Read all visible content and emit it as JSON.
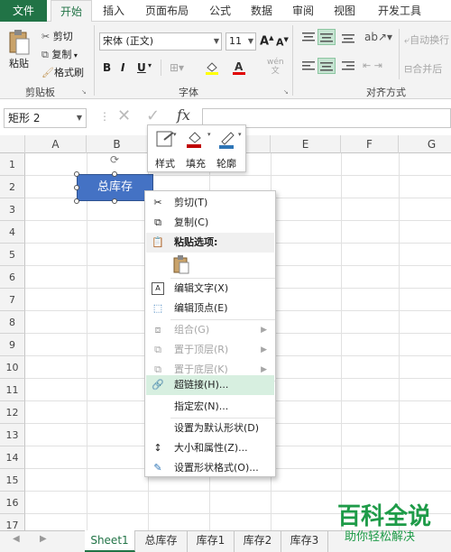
{
  "ribbon_tabs": [
    "文件",
    "开始",
    "插入",
    "页面布局",
    "公式",
    "数据",
    "审阅",
    "视图",
    "开发工具"
  ],
  "clipboard": {
    "paste": "粘贴",
    "cut": "剪切",
    "copy": "复制",
    "format_painter": "格式刷",
    "group": "剪贴板"
  },
  "font": {
    "name": "宋体 (正文)",
    "size": "11",
    "bold": "B",
    "italic": "I",
    "underline": "U",
    "group": "字体"
  },
  "alignment": {
    "wrap": "自动换行",
    "merge": "合并后",
    "group": "对齐方式"
  },
  "formula_bar": {
    "name_box": "矩形 2",
    "fx": "fx"
  },
  "columns": [
    "A",
    "B",
    "C",
    "D",
    "E",
    "F",
    "G"
  ],
  "rows": [
    "1",
    "2",
    "3",
    "4",
    "5",
    "6",
    "7",
    "8",
    "9",
    "10",
    "11",
    "12",
    "13",
    "14",
    "15",
    "16",
    "17"
  ],
  "shape": {
    "text": "总库存",
    "fill_color": "#4472c4"
  },
  "mini_toolbar": {
    "style": "样式",
    "fill": "填充",
    "outline": "轮廓"
  },
  "context_menu": [
    {
      "label": "剪切(T)",
      "icon": "cut-icon"
    },
    {
      "label": "复制(C)",
      "icon": "copy-icon"
    },
    {
      "label": "粘贴选项:",
      "icon": "paste-icon"
    },
    {
      "label": "编辑文字(X)",
      "icon": "edit-text-icon"
    },
    {
      "label": "编辑顶点(E)",
      "icon": "edit-points-icon"
    },
    {
      "label": "组合(G)",
      "icon": "group-icon"
    },
    {
      "label": "置于顶层(R)",
      "icon": "bring-front-icon"
    },
    {
      "label": "置于底层(K)",
      "icon": "send-back-icon"
    },
    {
      "label": "超链接(H)...",
      "icon": "hyperlink-icon"
    },
    {
      "label": "指定宏(N)...",
      "icon": ""
    },
    {
      "label": "设置为默认形状(D)",
      "icon": ""
    },
    {
      "label": "大小和属性(Z)...",
      "icon": "size-icon"
    },
    {
      "label": "设置形状格式(O)...",
      "icon": "format-shape-icon"
    }
  ],
  "sheet_tabs": [
    "Sheet1",
    "总库存",
    "库存1",
    "库存2",
    "库存3"
  ],
  "watermark": {
    "title": "百科全说",
    "subtitle": "助你轻松解决"
  },
  "colors": {
    "accent": "#217346",
    "hover": "#d7efe0"
  }
}
